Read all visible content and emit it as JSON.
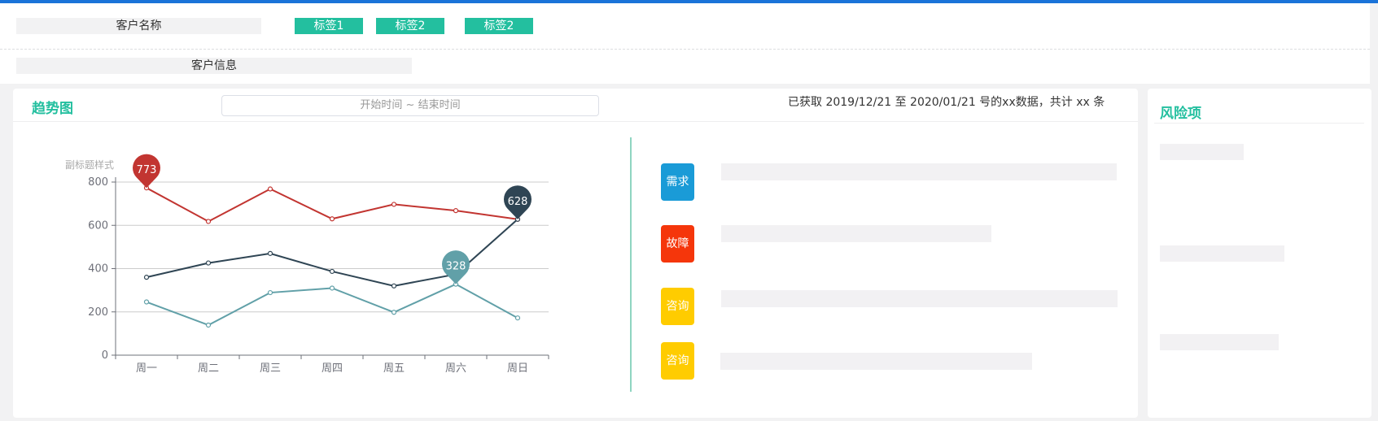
{
  "header": {
    "customer_name": "客户名称",
    "tags": [
      "标签1",
      "标签2",
      "标签2"
    ],
    "customer_info": "客户信息"
  },
  "trend": {
    "title": "趋势图",
    "date_range_placeholder": "开始时间 ~  结束时间",
    "summary": "已获取 2019/12/21 至 2020/01/21 号的xx数据，共计 xx 条"
  },
  "categories_panel": {
    "items": [
      {
        "label": "需求",
        "color": "#1a9bd7"
      },
      {
        "label": "故障",
        "color": "#f5360b"
      },
      {
        "label": "咨询",
        "color": "#ffcc00"
      },
      {
        "label": "咨询",
        "color": "#ffcc00"
      }
    ]
  },
  "risk": {
    "title": "风险项"
  },
  "chart_data": {
    "type": "line",
    "title": "",
    "subtitle": "副标题样式",
    "categories": [
      "周一",
      "周二",
      "周三",
      "周四",
      "周五",
      "周六",
      "周日"
    ],
    "ylim": [
      0,
      800
    ],
    "yticks": [
      0,
      200,
      400,
      600,
      800
    ],
    "grid": true,
    "series": [
      {
        "values": [
          773,
          618,
          768,
          630,
          697,
          668,
          628
        ],
        "color": "#c23531",
        "markers": [
          {
            "index": 0,
            "value": "773"
          }
        ]
      },
      {
        "values": [
          360,
          426,
          470,
          387,
          320,
          374,
          628
        ],
        "color": "#2f4554",
        "markers": [
          {
            "index": 6,
            "value": "628"
          }
        ]
      },
      {
        "values": [
          246,
          139,
          289,
          310,
          198,
          328,
          172
        ],
        "color": "#61a0a8",
        "markers": [
          {
            "index": 5,
            "value": "328"
          }
        ]
      }
    ]
  }
}
